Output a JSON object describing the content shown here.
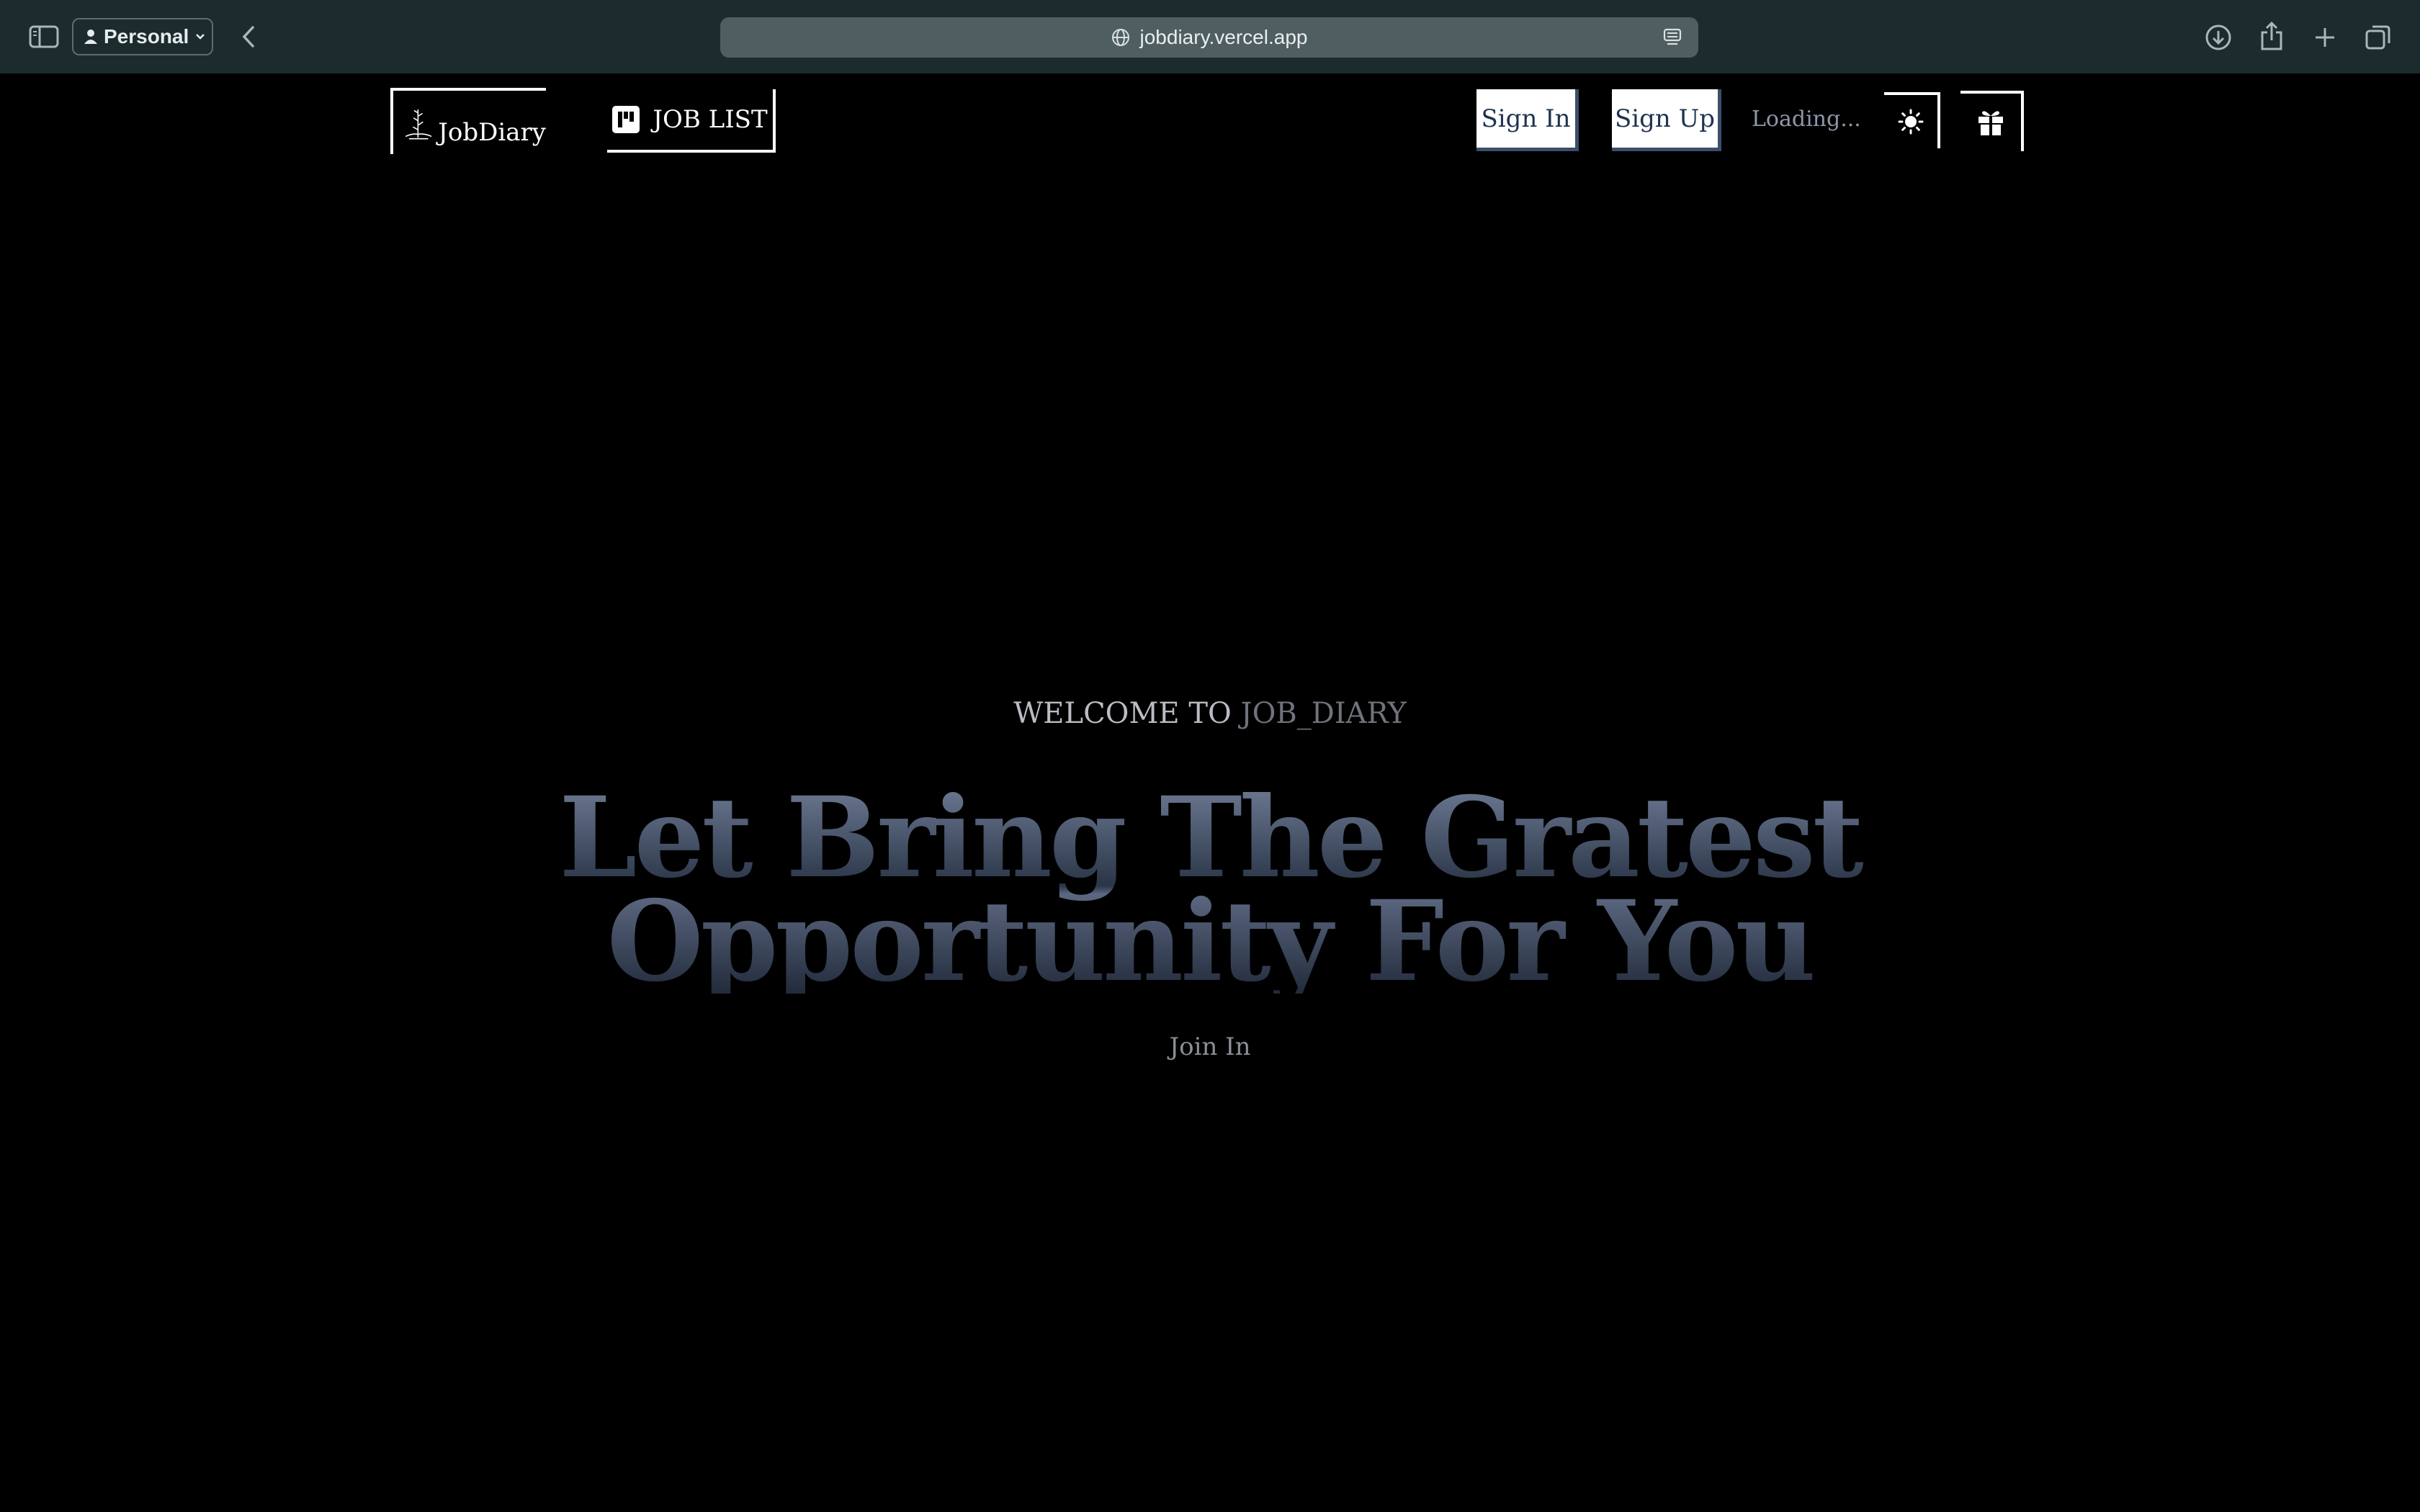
{
  "browser": {
    "profile_label": "Personal",
    "url": "jobdiary.vercel.app",
    "icons": [
      "sidebar-icon",
      "person-icon",
      "chevron-down-icon",
      "back-icon",
      "globe-icon",
      "reader-icon",
      "download-icon",
      "share-icon",
      "plus-icon",
      "tabs-overview-icon"
    ]
  },
  "nav": {
    "logo_text": "JobDiary",
    "job_list_label": "JOB LIST",
    "sign_in_label": "Sign In",
    "sign_up_label": "Sign Up",
    "loading_text": "Loading...",
    "icons": [
      "sun-icon",
      "gift-icon",
      "kanban-icon"
    ]
  },
  "hero": {
    "welcome_part1": "WELCOME TO ",
    "welcome_part2": "JOB_DIARY",
    "headline_line1": "Let Bring The Gratest",
    "headline_line2": "Opportunity For You",
    "join_label": "Join In"
  },
  "colors": {
    "chrome_bg": "#1b2b2e",
    "urlbar_bg": "#4f5f61",
    "page_bg": "#000000",
    "button_text": "#1f3350",
    "headline_light": "#6b7891",
    "headline_dark": "#2a3547"
  }
}
